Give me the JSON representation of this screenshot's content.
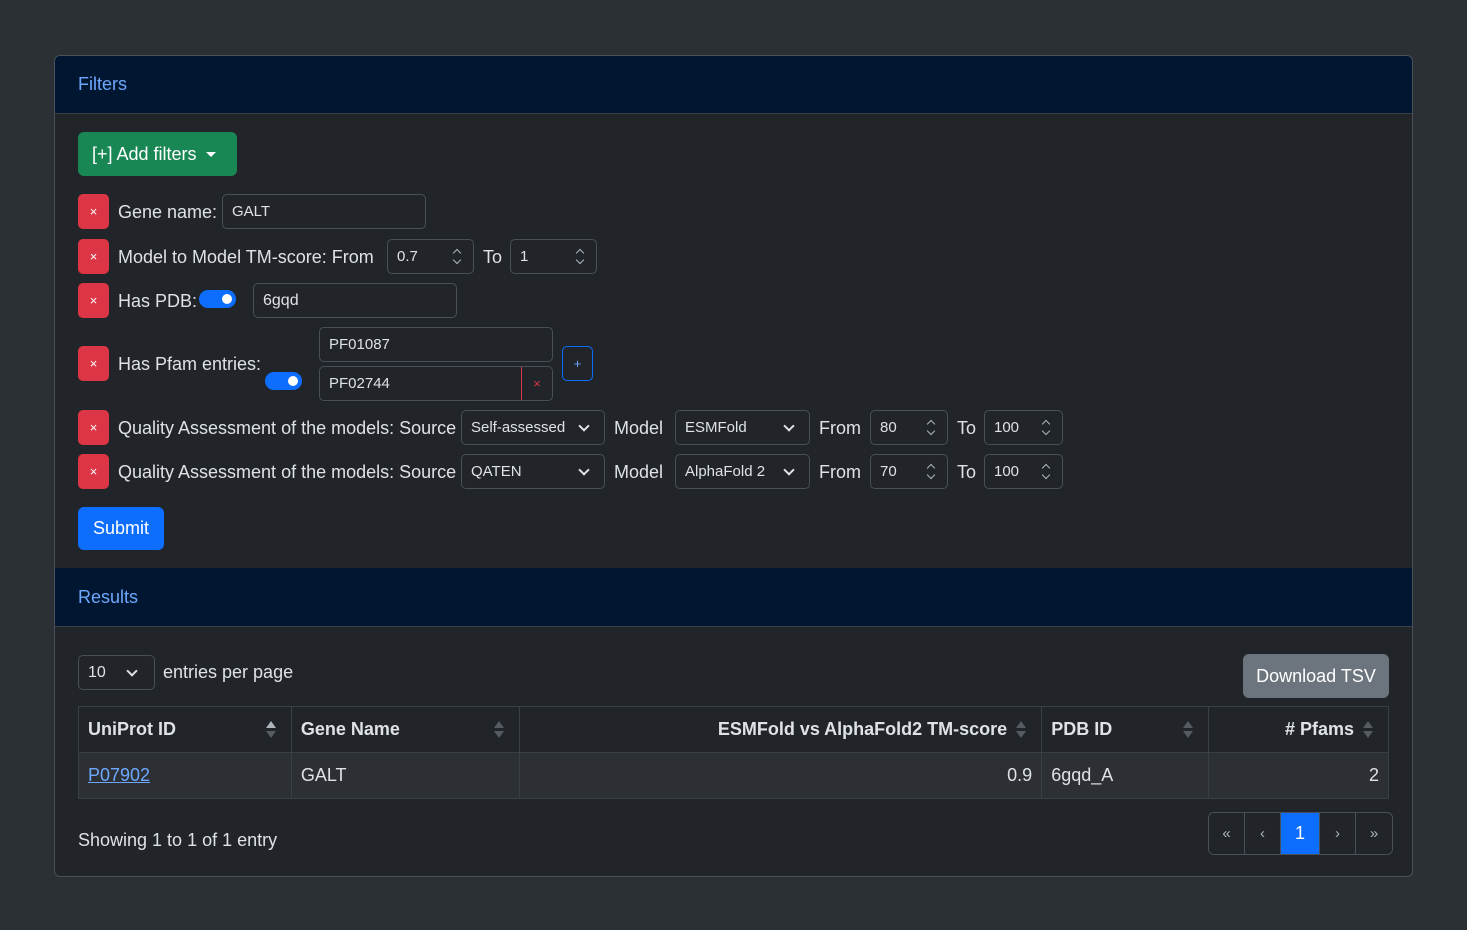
{
  "filters": {
    "header": "Filters",
    "add_filters_label": "[+] Add filters",
    "remove_label": "×",
    "gene_name": {
      "label": "Gene name:",
      "value": "GALT"
    },
    "tm_score": {
      "label": "Model to Model TM-score: From",
      "from": "0.7",
      "to_label": "To",
      "to": "1"
    },
    "has_pdb": {
      "label": "Has PDB:",
      "value": "6gqd"
    },
    "has_pfam": {
      "label": "Has Pfam entries:",
      "entries": [
        "PF01087",
        "PF02744"
      ],
      "add_label": "+"
    },
    "qa": [
      {
        "label": "Quality Assessment of the models: Source",
        "source": "Self-assessed",
        "model_label": "Model",
        "model": "ESMFold",
        "from_label": "From",
        "from": "80",
        "to_label": "To",
        "to": "100"
      },
      {
        "label": "Quality Assessment of the models: Source",
        "source": "QATEN",
        "model_label": "Model",
        "model": "AlphaFold 2",
        "from_label": "From",
        "from": "70",
        "to_label": "To",
        "to": "100"
      }
    ],
    "submit_label": "Submit"
  },
  "results": {
    "header": "Results",
    "per_page": "10",
    "per_page_label": "entries per page",
    "download_label": "Download TSV",
    "columns": [
      "UniProt ID",
      "Gene Name",
      "ESMFold vs AlphaFold2 TM-score",
      "PDB ID",
      "# Pfams"
    ],
    "rows": [
      [
        "P07902",
        "GALT",
        "0.9",
        "6gqd_A",
        "2"
      ]
    ],
    "summary": "Showing 1 to 1 of 1 entry",
    "pagination": [
      "«",
      "‹",
      "1",
      "›",
      "»"
    ]
  }
}
